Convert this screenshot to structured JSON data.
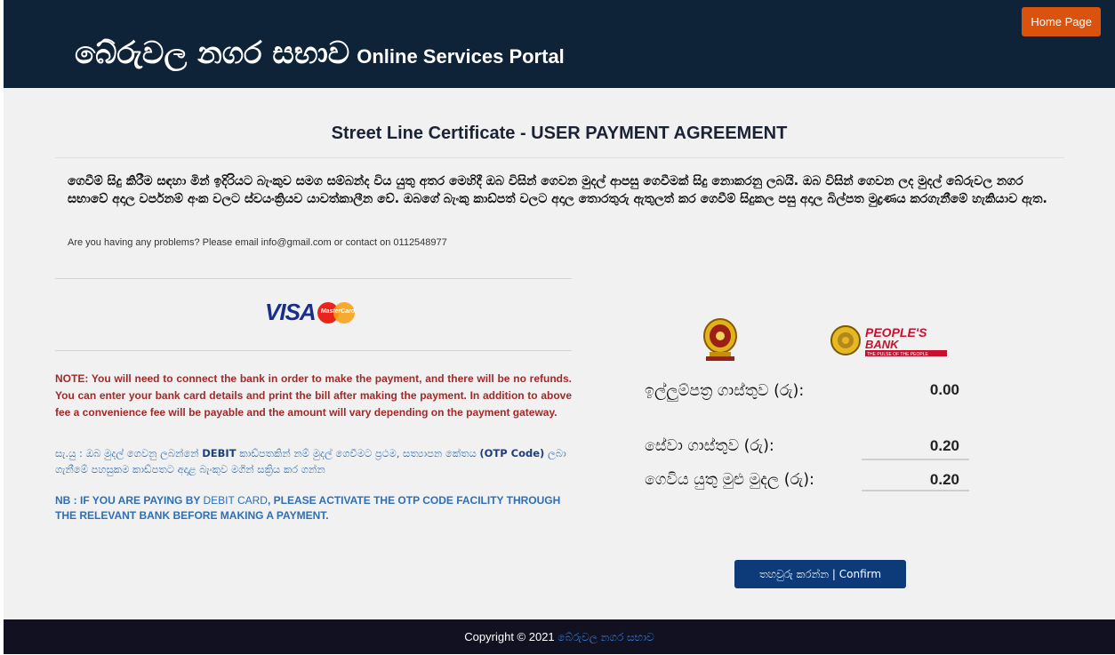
{
  "header": {
    "brand_sinhala": "බේරුවල නගර සභාව",
    "brand_english": "Online Services Portal",
    "home_button": "Home Page"
  },
  "main": {
    "title": "Street Line Certificate - USER PAYMENT AGREEMENT",
    "intro": "ගෙවීම් සිදු කිරීම සඳහා මින් ඉදිරියට බැංකුව සමග සම්බන්ද විය යුතු අතර මෙහිදී ඔබ විසින් ගෙවන මුදල් ආපසු ගෙවීමක් සිදු නොකරනු ලබයි. ඔබ විසින් ගෙවන ලද මුදල් බේරුවල නගර සභාවේ අදාල වර්පනම් අංක වලට ස්වයංක්‍රියව යාවත්කාලීන වේ. ඔබගේ බැංකු කාඩ්පත් වලට අදාල තොරතුරු ඇතුලත් කර ගෙවීම් සිදුකල පසු අදාල බිල්පත මුද්‍රණය කරගැනීමේ හැකියාව ඇත.",
    "contact": "Are you having any problems? Please email info@gmail.com or contact on 0112548977",
    "card_logo_visa": "VISA",
    "card_logo_mastercard": "MasterCard",
    "note": "NOTE: You will need to connect the bank in order to make the payment, and there will be no refunds. You can enter your bank card details and print the bill after making the payment. In addition to above fee a convenience fee will be payable and the amount will vary depending on the payment gateway.",
    "si_note": {
      "part1": "සැ.යු : ඔබ මුදල් ගෙවනු ලබන්නේ ",
      "debit": "DEBIT",
      "part2": " කාඩ්පතකින් නම් මුදල් ගෙවීමට ප්‍රථම, සත්‍යාපන කේතය ",
      "otp": "(OTP Code)",
      "part3": " ලබා ගැනීමේ පහසුකම කාඩ්පතට අදාළ බැංකුව මගින් සක්‍රිය කර ගන්න"
    },
    "nb": {
      "part1": "NB : IF YOU ARE PAYING BY ",
      "debit_card": "DEBIT CARD",
      "part2": ", PLEASE ACTIVATE THE OTP CODE FACILITY THROUGH THE RELEVANT BANK BEFORE MAKING A PAYMENT."
    },
    "bank_logo": {
      "name_line1": "PEOPLE'S",
      "name_line2": "BANK",
      "tagline": "THE PULSE OF THE PEOPLE"
    },
    "fees": [
      {
        "label": "ඉල්ලුම්පත්‍ර ගාස්තුව (රු):",
        "value": "0.00"
      },
      {
        "label": "සේවා ගාස්තුව (රු):",
        "value": "0.20"
      },
      {
        "label": "ගෙවිය යුතු මුළු මුදල (රු):",
        "value": "0.20"
      }
    ],
    "confirm_button": "තහවුරු කරන්න | Confirm"
  },
  "footer": {
    "copyright": "Copyright © 2021 ",
    "link": "බේරුවල නගර සභාව"
  },
  "colors": {
    "header_bg": "#0e2238",
    "home_button": "#d9530f",
    "note_red": "#a32929",
    "nb_blue": "#2e6fb5",
    "confirm_bg": "#0d3a78",
    "footer_bg": "#111122"
  }
}
